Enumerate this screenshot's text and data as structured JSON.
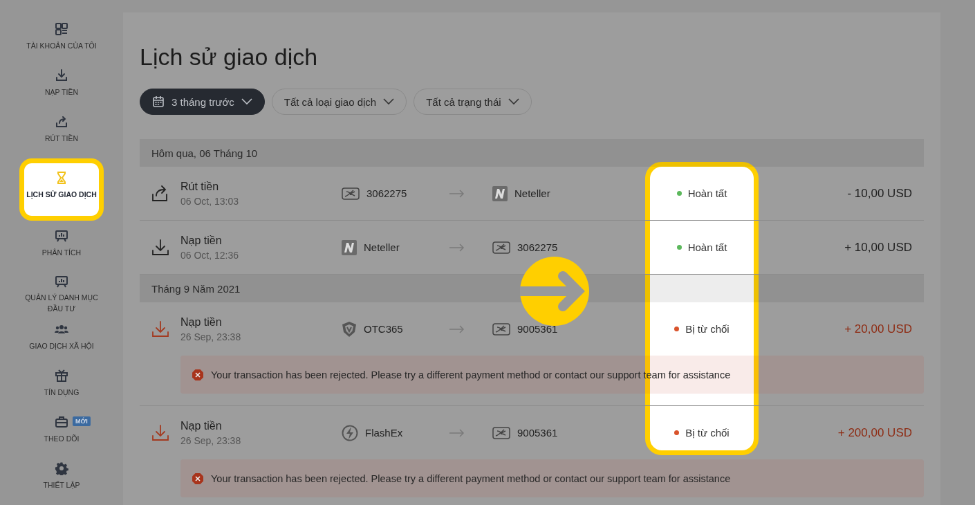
{
  "sidebar": {
    "items": [
      {
        "kind": "account",
        "label": "TÀI KHOẢN CỦA TÔI",
        "selected": false
      },
      {
        "kind": "deposit",
        "label": "NẠP TIỀN",
        "selected": false
      },
      {
        "kind": "withdraw",
        "label": "RÚT TIỀN",
        "selected": false
      },
      {
        "kind": "history",
        "label": "LỊCH SỬ GIAO DỊCH",
        "selected": true
      },
      {
        "kind": "analytics",
        "label": "PHÂN TÍCH",
        "selected": false
      },
      {
        "kind": "analytics",
        "label": "QUẢN LÝ DANH MỤC ĐẦU TƯ",
        "selected": false
      },
      {
        "kind": "social",
        "label": "GIAO DỊCH XÃ HỘI",
        "selected": false
      },
      {
        "kind": "credit",
        "label": "TÍN DỤNG",
        "selected": false
      },
      {
        "kind": "follow",
        "label": "THEO DÕI",
        "badge": "MỚI",
        "selected": false
      },
      {
        "kind": "settings",
        "label": "THIẾT LẬP",
        "selected": false
      }
    ]
  },
  "title": "Lịch sử giao dịch",
  "filters": [
    {
      "kind": "date",
      "label": "3 tháng trước",
      "selected": true
    },
    {
      "kind": "type",
      "label": "Tất cả loại giao dịch",
      "selected": false
    },
    {
      "kind": "status",
      "label": "Tất cả trạng thái",
      "selected": false
    }
  ],
  "status_spotlight": true,
  "groups": [
    {
      "header": "Hôm qua, 06 Tháng 10",
      "transactions": [
        {
          "kind": "withdraw",
          "title": "Rút tiền",
          "time": "06 Oct, 13:03",
          "from": {
            "kind": "card",
            "label": "3062275"
          },
          "to": {
            "kind": "neteller",
            "label": "Neteller"
          },
          "status": {
            "kind": "completed",
            "label": "Hoàn tất",
            "color": "#5cb85c"
          },
          "amount": "- 10,00 USD"
        },
        {
          "kind": "deposit",
          "title": "Nạp tiền",
          "time": "06 Oct, 12:36",
          "from": {
            "kind": "neteller",
            "label": "Neteller"
          },
          "to": {
            "kind": "card",
            "label": "3062275"
          },
          "status": {
            "kind": "completed",
            "label": "Hoàn tất",
            "color": "#5cb85c"
          },
          "amount": "+ 10,00 USD"
        }
      ]
    },
    {
      "header": "Tháng 9 Năm 2021",
      "transactions": [
        {
          "kind": "deposit",
          "title": "Nạp tiền",
          "time": "26 Sep, 23:38",
          "from": {
            "kind": "shield",
            "label": "OTC365"
          },
          "to": {
            "kind": "card",
            "label": "9005361"
          },
          "status": {
            "kind": "rejected",
            "label": "Bị từ chối",
            "color": "#d9532c"
          },
          "amount": "+ 20,00 USD",
          "error": "Your transaction has been rejected. Please try a different payment method or contact our support team for assistance"
        },
        {
          "kind": "deposit",
          "title": "Nạp tiền",
          "time": "26 Sep, 23:38",
          "from": {
            "kind": "flash",
            "label": "FlashEx"
          },
          "to": {
            "kind": "card",
            "label": "9005361"
          },
          "status": {
            "kind": "rejected",
            "label": "Bị từ chối",
            "color": "#d9532c"
          },
          "amount": "+ 200,00 USD",
          "error": "Your transaction has been rejected. Please try a different payment method or contact our support team for assistance"
        }
      ]
    }
  ]
}
